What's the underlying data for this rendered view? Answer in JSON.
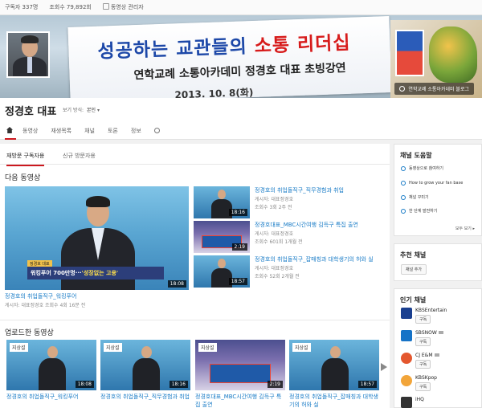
{
  "stats": {
    "subscribers": "구독자 337명",
    "views": "조회수 79,892회",
    "manager": "동영상 관리자"
  },
  "banner": {
    "headline_blue": "성공하는 교관들의 ",
    "headline_red": "소통 리더십",
    "subtitle": "연학교례 소통아카데미 정경호 대표 초빙강연",
    "date": "2013. 10. 8(화)",
    "channel_link": "연학교례 소통아카데미 블로그"
  },
  "channel": {
    "title": "정경호 대표",
    "view_as_label": "보기 방식:",
    "view_as_value": "본인"
  },
  "tabs": [
    "동영상",
    "재생목록",
    "채널",
    "토론",
    "정보"
  ],
  "subtabs": [
    "재방문 구독자용",
    "신규 방문자용"
  ],
  "sections": {
    "next_video": "다음 동영상",
    "uploaded": "업로드한 동영상"
  },
  "featured": {
    "caption_tag": "정경호 대표",
    "caption_text": "워킹푸어 700만명···",
    "caption_highlight": "'성장없는 고용'",
    "duration": "18:08",
    "title": "정경호의 취업돌직구_워킹푸어",
    "meta": "게시자: 대표정경호   조회수 4회   16분 전"
  },
  "side_videos": [
    {
      "title": "정경호의 취업돌직구_직무경험과 취업",
      "author": "게시자: 대표정경호",
      "meta": "조회수 3회   2주 전",
      "duration": "18:16"
    },
    {
      "title": "정경호대표_MBC시간여행 김득구 특집 출연",
      "author": "게시자: 대표정경호",
      "meta": "조회수 601회   1개월 전",
      "duration": "2:19"
    },
    {
      "title": "정경호의 취업돌직구_잡매칭과 대학생기의 허와 실",
      "author": "게시자: 대표정경호",
      "meta": "조회수 52회   2개월 전",
      "duration": "18:57"
    }
  ],
  "uploads": [
    {
      "tag": "지상설",
      "duration": "18:08",
      "title": "정경호의 취업돌직구_워킹푸어"
    },
    {
      "tag": "지상설",
      "duration": "18:16",
      "title": "정경호의 취업돌직구_직무경험과 취업"
    },
    {
      "tag": "지상설",
      "duration": "2:19",
      "title": "정경호대표_MBC시간여행 김득구 특집 출연"
    },
    {
      "tag": "지상설",
      "duration": "18:57",
      "title": "정경호의 취업돌직구_잡매칭과 대학생기의 허와 실"
    }
  ],
  "sidebar": {
    "help_title": "채널 도움말",
    "help_items": [
      "동영상으로 참여하기",
      "How to grow your fan base",
      "채널 꾸미기",
      "한 단계 발전하기"
    ],
    "help_more": "모두 보기 ▸",
    "recommend_title": "추천 채널",
    "recommend_button": "채널 추가",
    "popular_title": "인기 채널",
    "popular": [
      {
        "name": "KBSEntertain",
        "sub": "구독",
        "color": "#1a3f8f"
      },
      {
        "name": "SBSNOW",
        "sub": "구독",
        "color": "#1673c7"
      },
      {
        "name": "CJ E&M",
        "sub": "구독",
        "color": "#e4572e"
      },
      {
        "name": "KBSKpop",
        "sub": "구독",
        "color": "#f2a53a"
      },
      {
        "name": "iHQ",
        "sub": "",
        "color": "#333333"
      }
    ]
  }
}
